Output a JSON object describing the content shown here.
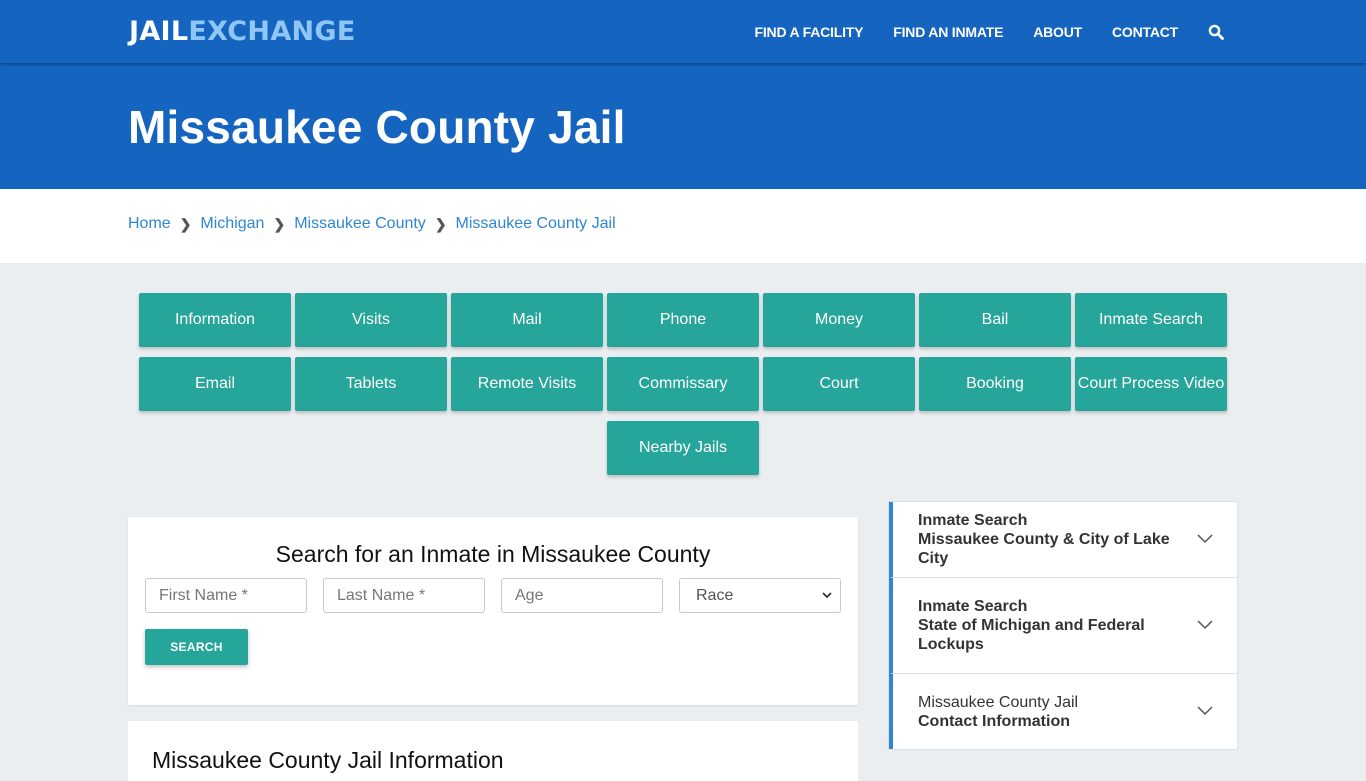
{
  "brand": {
    "part1": "JAIL",
    "part2": "EXCHANGE"
  },
  "nav": {
    "items": [
      "FIND A FACILITY",
      "FIND AN INMATE",
      "ABOUT",
      "CONTACT"
    ],
    "search_icon": "search-icon"
  },
  "hero": {
    "title": "Missaukee County Jail"
  },
  "breadcrumb": [
    "Home",
    "Michigan",
    "Missaukee County",
    "Missaukee County Jail"
  ],
  "tiles": [
    "Information",
    "Visits",
    "Mail",
    "Phone",
    "Money",
    "Bail",
    "Inmate Search",
    "Email",
    "Tablets",
    "Remote Visits",
    "Commissary",
    "Court",
    "Booking",
    "Court Process Video",
    "Nearby Jails"
  ],
  "search": {
    "title": "Search for an Inmate in Missaukee County",
    "first_name_placeholder": "First Name *",
    "last_name_placeholder": "Last Name *",
    "age_placeholder": "Age",
    "race_selected": "Race",
    "button": "SEARCH"
  },
  "info": {
    "title": "Missaukee County Jail Information"
  },
  "accordion": [
    {
      "line1": "Inmate Search",
      "line2": "Missaukee County & City of Lake City"
    },
    {
      "line1": "Inmate Search",
      "line2": "State of Michigan and Federal Lockups"
    },
    {
      "line1": "Missaukee County Jail",
      "line2": "Contact Information"
    }
  ],
  "colors": {
    "primary_blue": "#1565c0",
    "teal": "#26a69a",
    "link_blue": "#2f86d4",
    "logo_light": "#90c6f5"
  }
}
